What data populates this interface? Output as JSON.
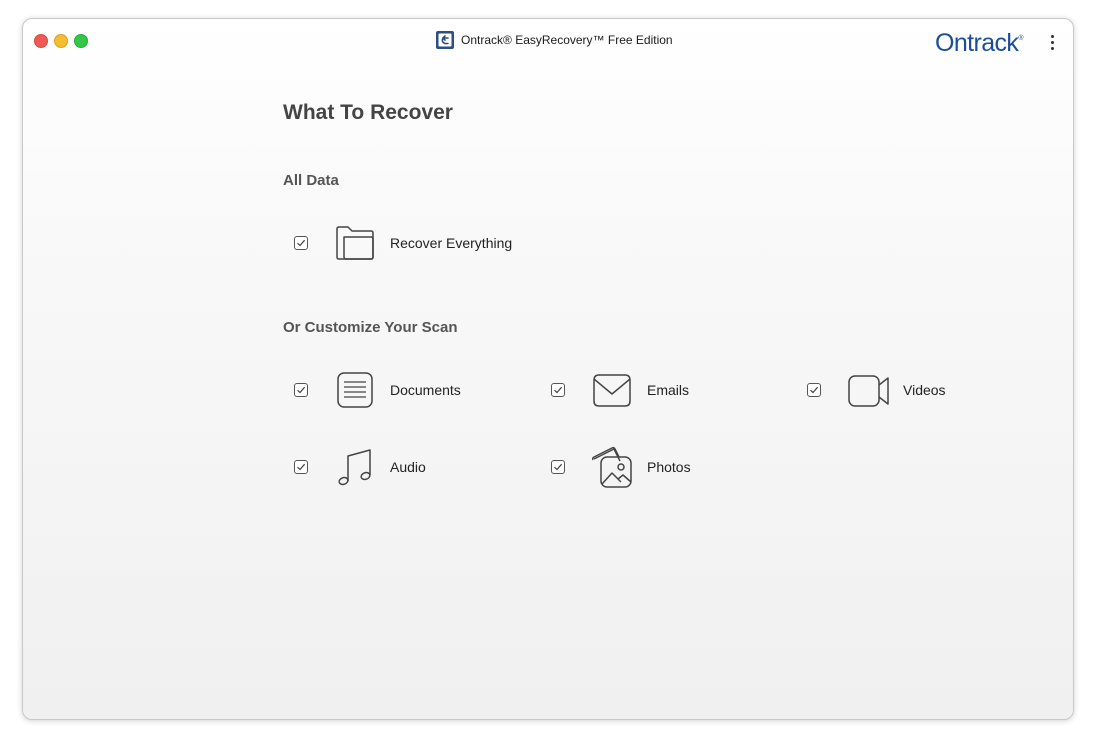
{
  "window": {
    "title": "Ontrack® EasyRecovery™ Free Edition",
    "brand_name": "Ontrack",
    "brand_mark": "®",
    "brand_color": "#1b4e96"
  },
  "main": {
    "heading": "What To Recover",
    "all_data_title": "All Data",
    "customize_title": "Or Customize Your Scan",
    "recover_everything": {
      "label": "Recover Everything",
      "checked": true,
      "icon": "folder-icon"
    },
    "options": [
      {
        "label": "Documents",
        "checked": true,
        "icon": "document-icon"
      },
      {
        "label": "Emails",
        "checked": true,
        "icon": "email-icon"
      },
      {
        "label": "Videos",
        "checked": true,
        "icon": "video-camera-icon"
      },
      {
        "label": "Audio",
        "checked": true,
        "icon": "music-note-icon"
      },
      {
        "label": "Photos",
        "checked": true,
        "icon": "photos-icon"
      }
    ]
  }
}
